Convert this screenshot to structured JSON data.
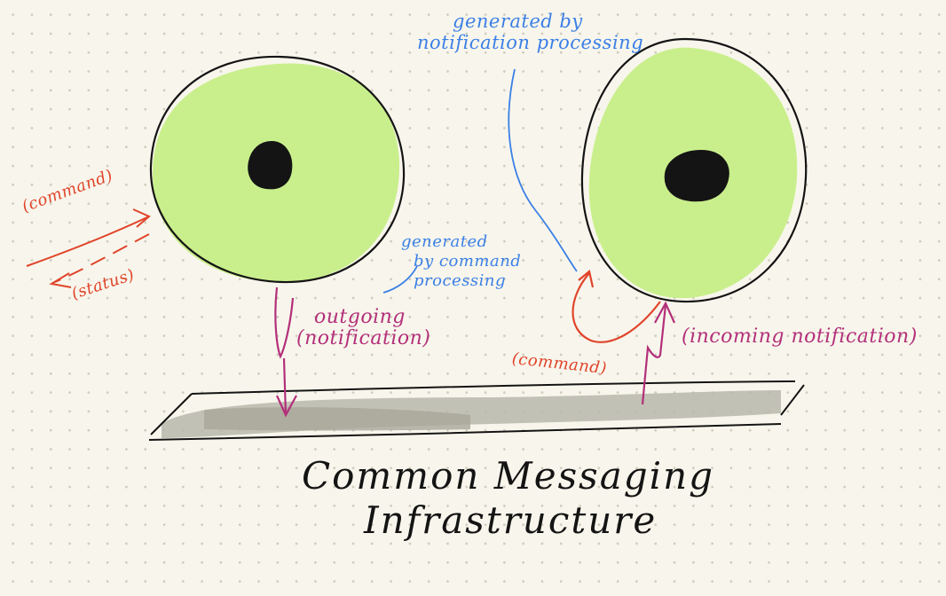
{
  "labels": {
    "notification_processing_note": {
      "line1": "generated by",
      "line2": "notification processing"
    },
    "command_processing_note": {
      "line1": "generated",
      "line2": "by command",
      "line3": "processing"
    },
    "command_in": "(command)",
    "status_out": "(status)",
    "outgoing": {
      "line1": "outgoing",
      "line2": "(notification)"
    },
    "command_right": "(command)",
    "incoming": "(incoming notification)",
    "infrastructure": {
      "line1": "Common Messaging",
      "line2": "Infrastructure"
    }
  },
  "colors": {
    "note_blue": "#3b7fe6",
    "command_red": "#e0442a",
    "notification_magenta": "#b3307a",
    "node_fill": "#c9ef8c",
    "bus_fill": "#b9b7ab",
    "ink": "#141414",
    "paper": "#f8f6ec"
  }
}
